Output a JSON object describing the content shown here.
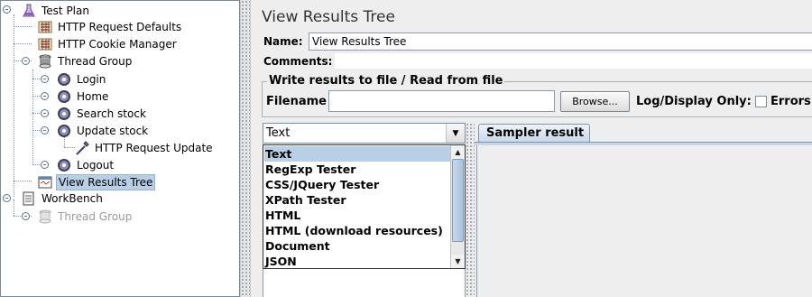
{
  "tree": {
    "nodes": [
      {
        "id": "test-plan",
        "label": "Test Plan",
        "icon": "beaker-icon"
      },
      {
        "id": "http-request-defaults",
        "label": "HTTP Request Defaults",
        "icon": "config-element-icon"
      },
      {
        "id": "http-cookie-manager",
        "label": "HTTP Cookie Manager",
        "icon": "config-element-icon"
      },
      {
        "id": "thread-group",
        "label": "Thread Group",
        "icon": "spool-icon"
      },
      {
        "id": "login",
        "label": "Login",
        "icon": "gear-icon"
      },
      {
        "id": "home",
        "label": "Home",
        "icon": "gear-icon"
      },
      {
        "id": "search-stock",
        "label": "Search stock",
        "icon": "gear-icon"
      },
      {
        "id": "update-stock",
        "label": "Update stock",
        "icon": "gear-icon"
      },
      {
        "id": "http-request-update",
        "label": "HTTP Request Update",
        "icon": "pipette-icon"
      },
      {
        "id": "logout",
        "label": "Logout",
        "icon": "gear-icon"
      },
      {
        "id": "view-results-tree",
        "label": "View Results Tree",
        "icon": "listener-icon",
        "selected": true
      },
      {
        "id": "workbench",
        "label": "WorkBench",
        "icon": "workbench-icon"
      },
      {
        "id": "workbench-thread-group",
        "label": "Thread Group",
        "icon": "spool-icon",
        "disabled": true
      }
    ]
  },
  "panel": {
    "title": "View Results Tree",
    "name_label": "Name:",
    "name_value": "View Results Tree",
    "comments_label": "Comments:",
    "file_group_legend": "Write results to file / Read from file",
    "filename_label": "Filename",
    "filename_value": "",
    "browse_label": "Browse...",
    "log_display_label": "Log/Display Only:",
    "errors_label": "Errors",
    "errors_checked": false
  },
  "renderer": {
    "selected": "Text",
    "options": [
      "Text",
      "RegExp Tester",
      "CSS/JQuery Tester",
      "XPath Tester",
      "HTML",
      "HTML (download resources)",
      "Document",
      "JSON"
    ]
  },
  "tabs": {
    "sampler_result": "Sampler result"
  },
  "colors": {
    "selection": "#b8cfe5",
    "tree_connector": "#7d93ad"
  }
}
